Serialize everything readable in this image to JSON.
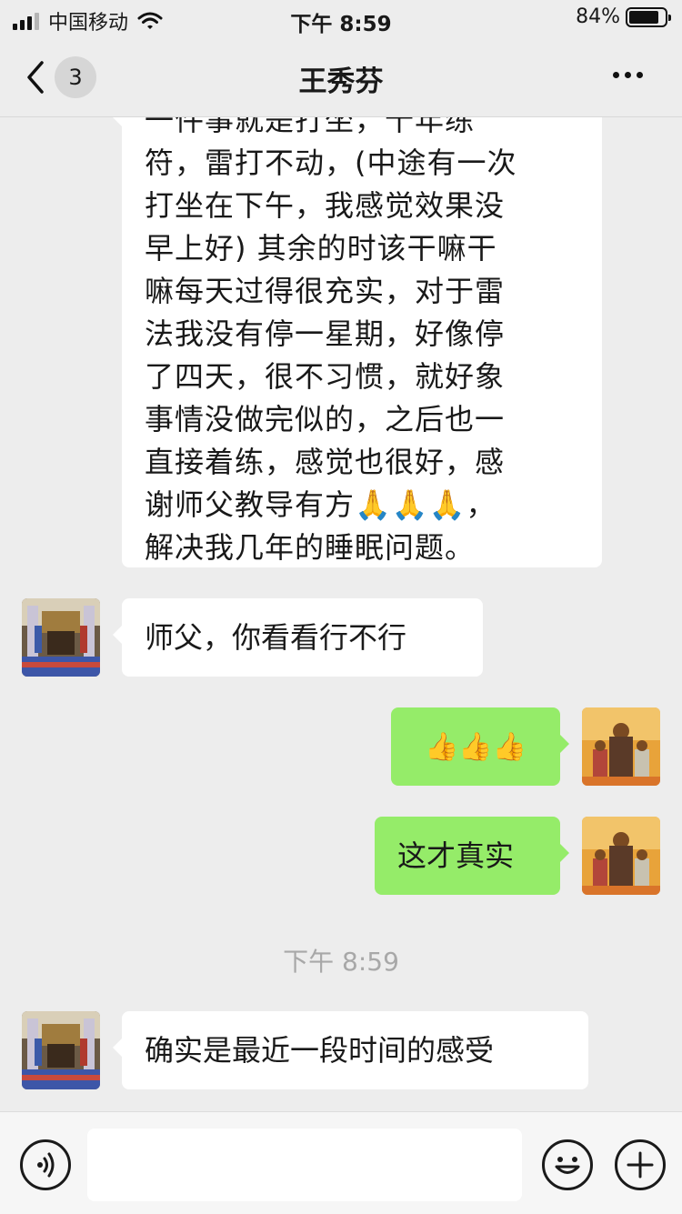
{
  "status_bar": {
    "carrier": "中国移动",
    "time": "下午 8:59",
    "battery_percent": "84%",
    "battery_level": 0.84
  },
  "nav": {
    "back_badge": "3",
    "title": "王秀芬"
  },
  "messages": {
    "long_text": "一件事就是打坐，十年练\n符，雷打不动，(中途有一次\n打坐在下午，我感觉效果没\n早上好) 其余的时该干嘛干\n嘛每天过得很充实，对于雷\n法我没有停一星期，好像停\n了四天，很不习惯，就好象\n事情没做完似的，之后也一\n直接着练，感觉也很好，感\n谢师父教导有方🙏🙏🙏，\n解决我几年的睡眠问题。",
    "m2": "师父，你看看行不行",
    "m3_emoji": "👍👍👍",
    "m4": "这才真实",
    "timestamp": "下午 8:59",
    "m5": "确实是最近一段时间的感受"
  },
  "colors": {
    "background": "#ededed",
    "sent_bubble": "#95ec69",
    "received_bubble": "#ffffff"
  },
  "icons": {
    "voice": "voice-icon",
    "emoji": "emoji-icon",
    "add": "add-icon",
    "back": "chevron-left-icon",
    "more": "more-icon"
  }
}
